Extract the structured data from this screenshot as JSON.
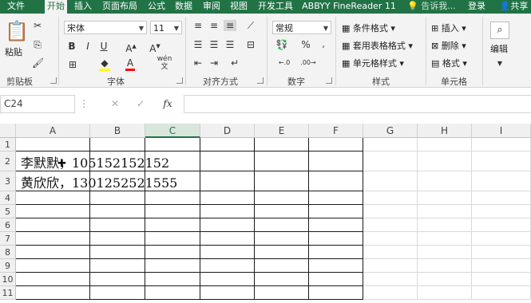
{
  "tabs": [
    "文件",
    "开始",
    "插入",
    "页面布局",
    "公式",
    "数据",
    "审阅",
    "视图",
    "开发工具",
    "ABBYY FineReader 11"
  ],
  "active_tab": "开始",
  "tell_me": "告诉我...",
  "login": "登录",
  "share": "共享",
  "clipboard": {
    "paste": "粘贴",
    "group": "剪贴板"
  },
  "font": {
    "name": "宋体",
    "size": "11",
    "group": "字体",
    "wen": "wén"
  },
  "alignment": {
    "group": "对齐方式"
  },
  "number": {
    "format": "常规",
    "group": "数字"
  },
  "styles": {
    "conditional": "条件格式",
    "table": "套用表格格式",
    "cell": "单元格样式",
    "group": "样式"
  },
  "cells": {
    "insert": "插入",
    "delete": "删除",
    "format": "格式",
    "group": "单元格"
  },
  "editing": {
    "label": "编辑"
  },
  "namebox": "C24",
  "fx": "fx",
  "columns": [
    "A",
    "B",
    "C",
    "D",
    "E",
    "F",
    "G",
    "H",
    "I"
  ],
  "selected_column": "C",
  "rows": [
    "1",
    "2",
    "3",
    "4",
    "5",
    "6",
    "7",
    "8",
    "9",
    "10",
    "11"
  ],
  "cells_data": {
    "r2": "李默默，105152152152",
    "r3": "黄欣欣，1301252521555"
  },
  "colors": {
    "accent": "#217346",
    "font_color": "#ff0000",
    "highlight": "#ffff00"
  }
}
